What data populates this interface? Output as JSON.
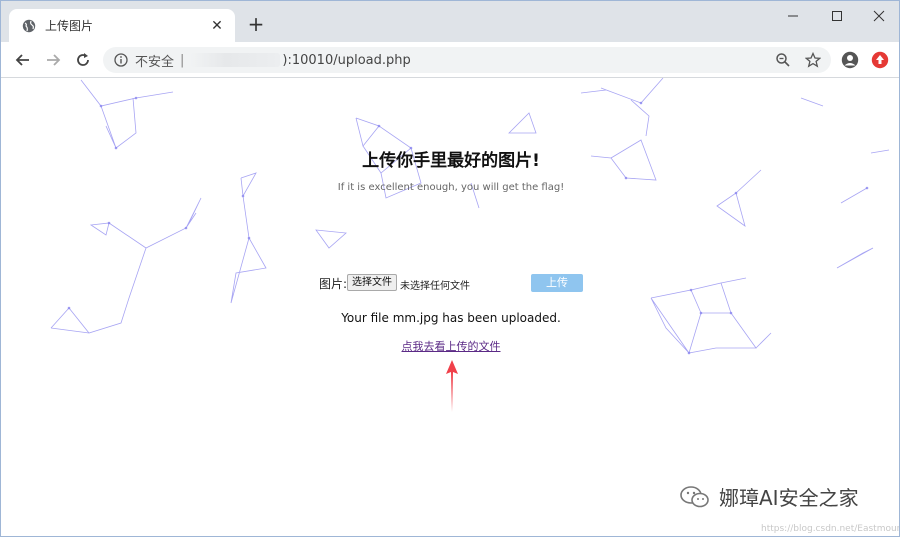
{
  "browser": {
    "tab_title": "上传图片",
    "address": {
      "security_label": "不安全",
      "separator": "|",
      "url_suffix": "):10010/upload.php"
    }
  },
  "page": {
    "heading": "上传你手里最好的图片!",
    "subtitle": "If it is excellent enough, you will get the flag!",
    "file_label": "图片:",
    "choose_file_label": "选择文件",
    "no_file_label": "未选择任何文件",
    "upload_label": "上传",
    "status_message": "Your file mm.jpg has been uploaded.",
    "view_link": "点我去看上传的文件"
  },
  "watermark": {
    "text": "娜璋AI安全之家",
    "small_text": "https://blog.csdn.net/Eastmount"
  },
  "colors": {
    "upload_button": "#8fc5ef",
    "link": "#5b2a86",
    "arrow": "#f0404a",
    "network_lines": "#8a86ef"
  },
  "icons": [
    "globe-icon",
    "close-icon",
    "plus-icon",
    "minimize-icon",
    "maximize-icon",
    "window-close-icon",
    "back-icon",
    "forward-icon",
    "reload-icon",
    "info-icon",
    "zoom-icon",
    "star-icon",
    "account-icon",
    "extension-icon",
    "wechat-icon",
    "arrow-up-icon"
  ]
}
